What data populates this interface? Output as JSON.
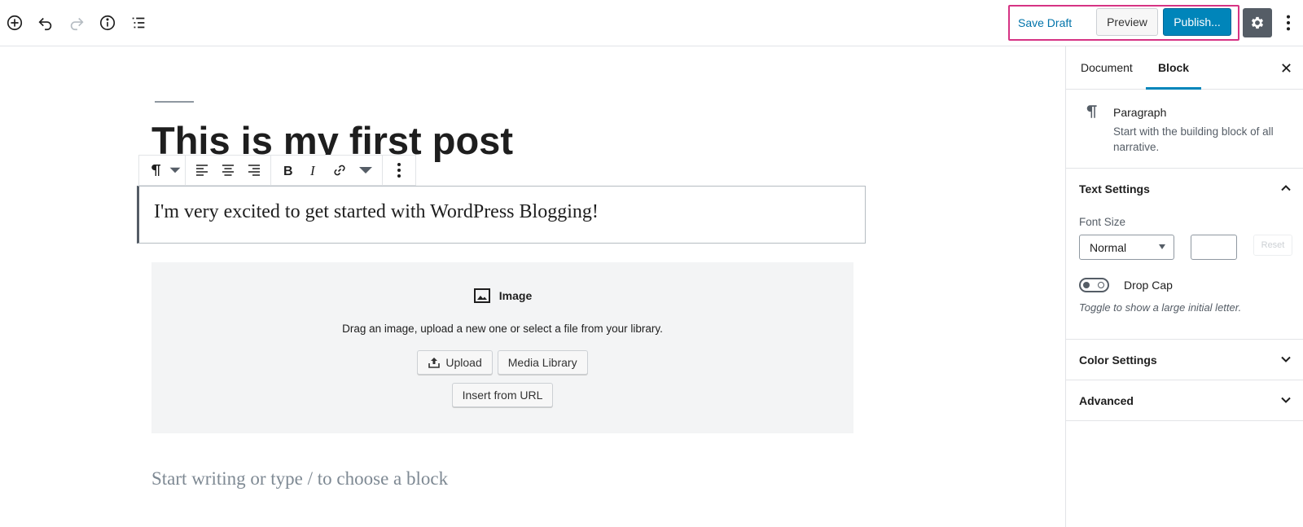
{
  "toolbar": {
    "icons": [
      "add-block-icon",
      "undo-icon",
      "redo-icon",
      "info-icon",
      "outline-icon"
    ],
    "save_draft": "Save Draft",
    "preview": "Preview",
    "publish": "Publish...",
    "settings_icon": "gear-icon",
    "more_icon": "vertical-ellipsis-icon",
    "highlight_color": "#d63384"
  },
  "editor": {
    "post_title": "This is my first post",
    "paragraph": "I'm very excited to get started with WordPress Blogging!",
    "image_block": {
      "label": "Image",
      "instructions": "Drag an image, upload a new one or select a file from your library.",
      "upload": "Upload",
      "media_library": "Media Library",
      "insert_url": "Insert from URL"
    },
    "placeholder": "Start writing or type / to choose a block"
  },
  "sidebar": {
    "tabs": [
      "Document",
      "Block"
    ],
    "active_tab": "Block",
    "block_card": {
      "title": "Paragraph",
      "description": "Start with the building block of all narrative."
    },
    "text_settings": {
      "title": "Text Settings",
      "font_size_label": "Font Size",
      "font_size_value": "Normal",
      "reset": "Reset",
      "drop_cap_label": "Drop Cap",
      "drop_cap_help": "Toggle to show a large initial letter."
    },
    "color_settings": "Color Settings",
    "advanced": "Advanced"
  },
  "colors": {
    "accent": "#0085ba",
    "link": "#0073aa",
    "placeholder_bg": "#f3f4f5"
  }
}
